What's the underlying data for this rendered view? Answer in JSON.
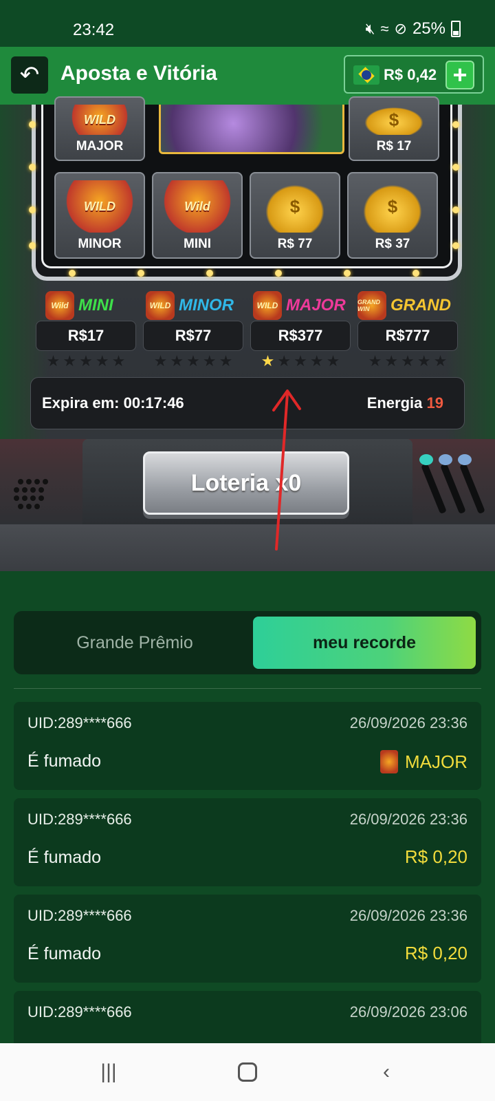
{
  "status_bar": {
    "time": "23:42",
    "battery": "25%"
  },
  "header": {
    "title": "Aposta e Vitória",
    "balance": "R$ 0,42"
  },
  "slot": {
    "tiles": [
      {
        "label": "MAJOR",
        "art": "WILD"
      },
      {
        "label": "R$ 17",
        "art": "$"
      },
      {
        "label": "MINOR",
        "art": "WILD"
      },
      {
        "label": "MINI",
        "art": "Wild"
      },
      {
        "label": "R$ 77",
        "art": "$"
      },
      {
        "label": "R$ 37",
        "art": "$"
      }
    ],
    "jackpots": [
      {
        "name": "MINI",
        "value": "R$17",
        "color": "#3ee04a",
        "icon": "Wild",
        "stars": 0
      },
      {
        "name": "MINOR",
        "value": "R$77",
        "color": "#30b8e8",
        "icon": "WILD",
        "stars": 0
      },
      {
        "name": "MAJOR",
        "value": "R$377",
        "color": "#ee3a9a",
        "icon": "WILD",
        "stars": 1
      },
      {
        "name": "GRAND",
        "value": "R$777",
        "color": "#f5c531",
        "icon": "GRAND WIN",
        "stars": 0
      }
    ],
    "expira": "Expira em: 00:17:46",
    "energia_label": "Energia",
    "energia_value": "19",
    "lottery_button": "Loteria x0"
  },
  "tabs": {
    "left": "Grande Prêmio",
    "right": "meu recorde"
  },
  "records": [
    {
      "uid": "UID:289****666",
      "date": "26/09/2026 23:36",
      "status": "É fumado",
      "prize": "MAJOR",
      "has_icon": true
    },
    {
      "uid": "UID:289****666",
      "date": "26/09/2026 23:36",
      "status": "É fumado",
      "prize": "R$ 0,20",
      "has_icon": false
    },
    {
      "uid": "UID:289****666",
      "date": "26/09/2026 23:36",
      "status": "É fumado",
      "prize": "R$ 0,20",
      "has_icon": false
    },
    {
      "uid": "UID:289****666",
      "date": "26/09/2026 23:06",
      "status": "",
      "prize": "",
      "has_icon": false
    }
  ],
  "colors": {
    "header": "#1f8a3c",
    "background": "#0f4a24",
    "prize": "#f2dc3c",
    "energia": "#f05a40"
  }
}
